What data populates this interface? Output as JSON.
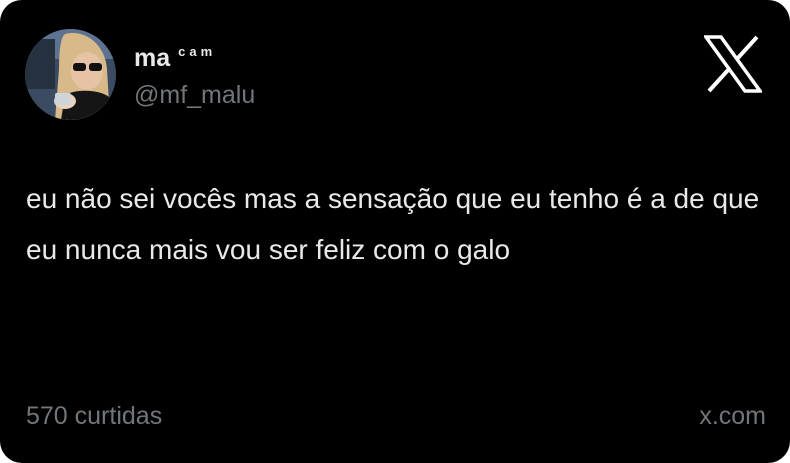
{
  "author": {
    "display_name": "ma",
    "display_name_suffix": "cam",
    "handle": "@mf_malu",
    "avatar": "profile-photo"
  },
  "brand": {
    "logo_icon": "x-logo-icon"
  },
  "tweet": {
    "text": "eu não sei vocês mas a sensação que eu tenho é a de que eu nunca mais vou ser feliz com o galo"
  },
  "footer": {
    "likes": "570 curtidas",
    "domain": "x.com"
  },
  "colors": {
    "background": "#000000",
    "primary_text": "#e7e9ea",
    "secondary_text": "#71767b"
  }
}
